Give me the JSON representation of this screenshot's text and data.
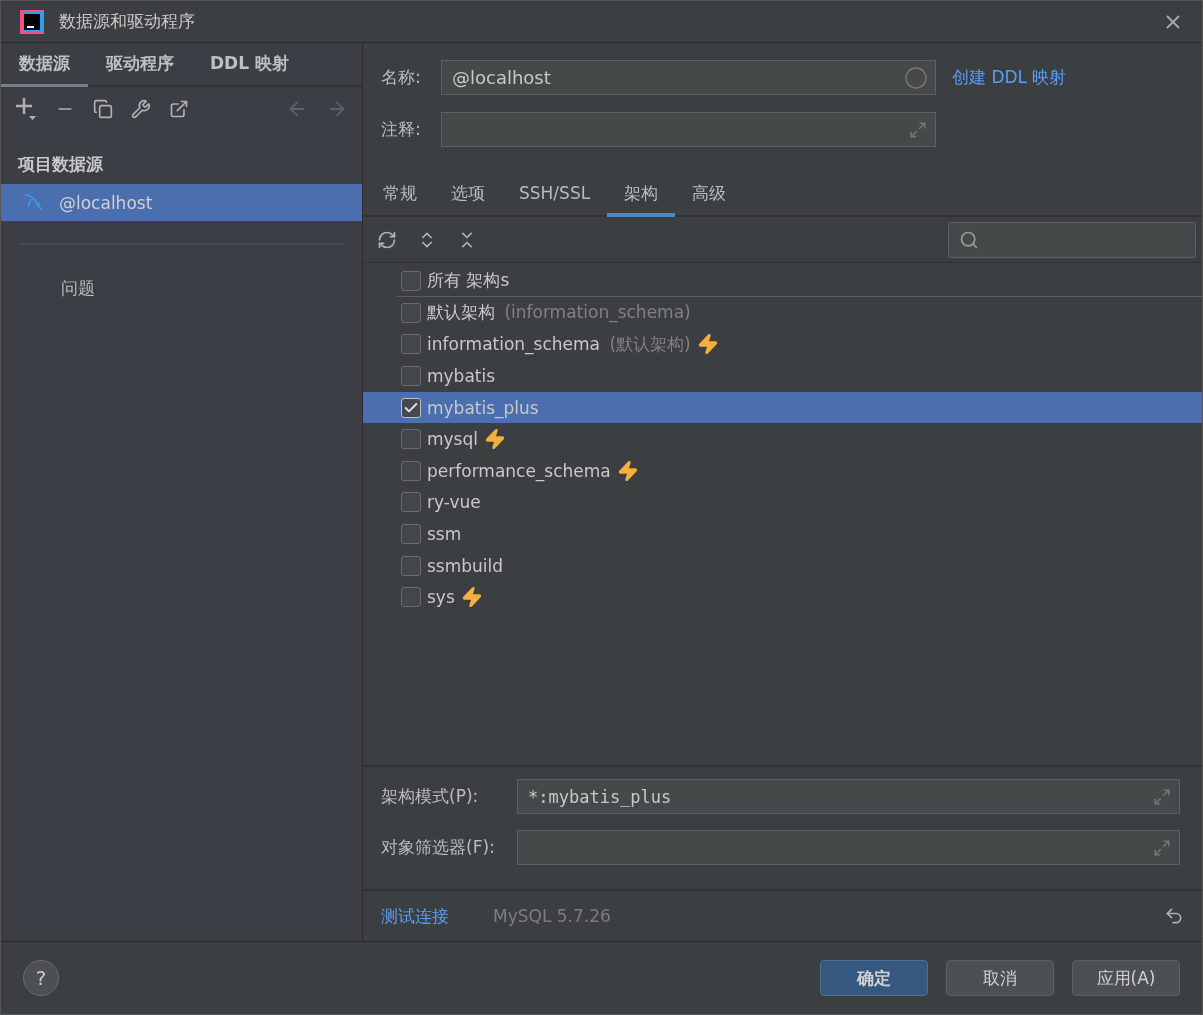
{
  "window": {
    "title": "数据源和驱动程序"
  },
  "left_tabs": [
    {
      "label": "数据源",
      "selected": true
    },
    {
      "label": "驱动程序",
      "selected": false
    },
    {
      "label": "DDL 映射",
      "selected": false
    }
  ],
  "sidebar": {
    "section": "项目数据源",
    "items": [
      {
        "label": "@localhost",
        "selected": true
      }
    ],
    "problems": "问题"
  },
  "form": {
    "name_label": "名称:",
    "name_value": "@localhost",
    "comment_label": "注释:",
    "ddl_link": "创建 DDL 映射"
  },
  "tabs": [
    {
      "label": "常规",
      "selected": false
    },
    {
      "label": "选项",
      "selected": false
    },
    {
      "label": "SSH/SSL",
      "selected": false
    },
    {
      "label": "架构",
      "selected": true
    },
    {
      "label": "高级",
      "selected": false
    }
  ],
  "schemas": [
    {
      "kind": "all",
      "label": "所有 架构s",
      "checked": false,
      "selected": false,
      "lightning": false
    },
    {
      "kind": "schema",
      "label": "默认架构",
      "note": "(information_schema)",
      "checked": false,
      "selected": false,
      "lightning": false
    },
    {
      "kind": "schema",
      "label": "information_schema",
      "note": "(默认架构)",
      "checked": false,
      "selected": false,
      "lightning": true
    },
    {
      "kind": "schema",
      "label": "mybatis",
      "checked": false,
      "selected": false,
      "lightning": false
    },
    {
      "kind": "schema",
      "label": "mybatis_plus",
      "checked": true,
      "selected": true,
      "lightning": false
    },
    {
      "kind": "schema",
      "label": "mysql",
      "checked": false,
      "selected": false,
      "lightning": true
    },
    {
      "kind": "schema",
      "label": "performance_schema",
      "checked": false,
      "selected": false,
      "lightning": true
    },
    {
      "kind": "schema",
      "label": "ry-vue",
      "checked": false,
      "selected": false,
      "lightning": false
    },
    {
      "kind": "schema",
      "label": "ssm",
      "checked": false,
      "selected": false,
      "lightning": false
    },
    {
      "kind": "schema",
      "label": "ssmbuild",
      "checked": false,
      "selected": false,
      "lightning": false
    },
    {
      "kind": "schema",
      "label": "sys",
      "checked": false,
      "selected": false,
      "lightning": true
    }
  ],
  "pattern": {
    "label": "架构模式(P):",
    "value": "*:mybatis_plus"
  },
  "filter": {
    "label": "对象筛选器(F):"
  },
  "footer": {
    "test_link": "测试连接",
    "version": "MySQL 5.7.26"
  },
  "help": "?",
  "buttons": [
    {
      "label": "确定",
      "primary": true
    },
    {
      "label": "取消",
      "primary": false
    },
    {
      "label": "应用(A)",
      "primary": false
    }
  ]
}
